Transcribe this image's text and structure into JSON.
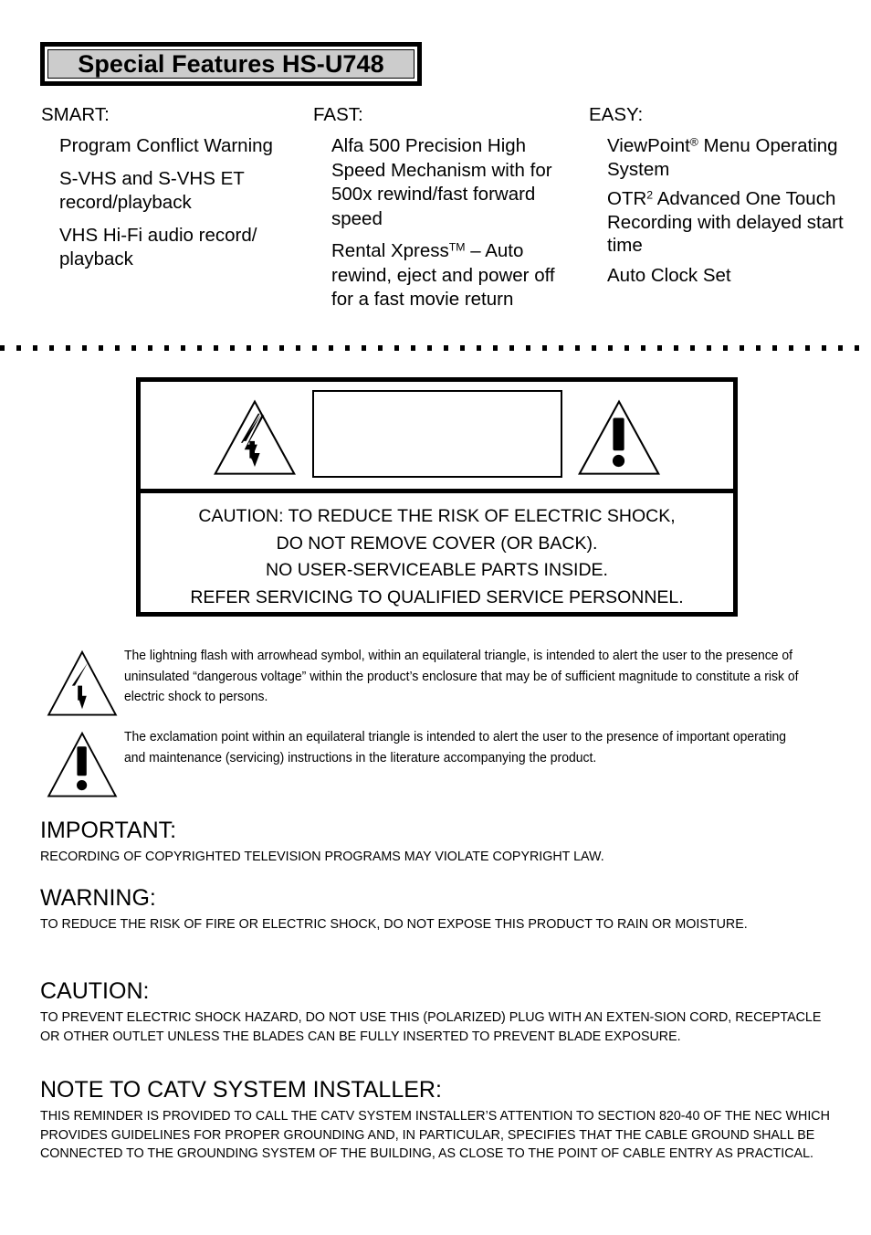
{
  "title": {
    "text": "Special Features HS-U748",
    "fill_color": "#cccccc"
  },
  "features": {
    "columns": [
      {
        "heading": "SMART:",
        "items": [
          "Program Conflict Warning",
          "S-VHS and S-VHS ET record/playback",
          "VHS Hi-Fi audio record/ playback"
        ]
      },
      {
        "heading": "FAST:",
        "items": [
          "Alfa 500 Precision High Speed Mechanism with for 500x rewind/fast forward speed",
          "Rental Xpress™ – Auto rewind, eject and power off for a fast movie return"
        ]
      },
      {
        "heading": "EASY:",
        "items": [
          "ViewPoint® Menu Operating System",
          "OTR² Advanced One Touch Recording with delayed start time",
          "Auto Clock Set"
        ]
      }
    ]
  },
  "caution_box": {
    "lines": [
      "CAUTION:  TO REDUCE THE RISK OF ELECTRIC SHOCK,",
      "DO NOT REMOVE COVER (OR BACK).",
      "NO USER-SERVICEABLE PARTS INSIDE.",
      "REFER SERVICING TO QUALIFIED SERVICE PERSONNEL."
    ]
  },
  "explanations": [
    {
      "icon": "lightning-bolt-triangle-icon",
      "text": "The lightning flash with arrowhead symbol, within an equilateral triangle, is intended to alert the user to the presence of uninsulated “dangerous voltage” within the product’s enclosure that may be of sufficient magnitude to constitute a risk of electric shock to persons."
    },
    {
      "icon": "exclamation-triangle-icon",
      "text": "The exclamation point within an equilateral triangle is intended to alert the user to the presence of important operating and maintenance (servicing) instructions in the literature accompanying the product."
    }
  ],
  "notices": [
    {
      "heading": "IMPORTANT:",
      "body": "RECORDING OF COPYRIGHTED TELEVISION PROGRAMS MAY VIOLATE COPYRIGHT LAW."
    },
    {
      "heading": "WARNING:",
      "body": "TO REDUCE THE RISK OF FIRE OR ELECTRIC SHOCK, DO NOT EXPOSE THIS PRODUCT TO RAIN OR MOISTURE."
    },
    {
      "heading": "CAUTION:",
      "body": "TO PREVENT ELECTRIC SHOCK HAZARD, DO NOT USE THIS (POLARIZED) PLUG WITH AN EXTEN-SION CORD, RECEPTACLE OR OTHER OUTLET UNLESS THE BLADES CAN BE FULLY INSERTED TO PREVENT BLADE EXPOSURE."
    },
    {
      "heading": "NOTE TO CATV SYSTEM INSTALLER:",
      "body": "THIS REMINDER IS PROVIDED TO CALL THE CATV SYSTEM INSTALLER’S ATTENTION TO SECTION 820-40 OF THE NEC WHICH PROVIDES GUIDELINES FOR PROPER GROUNDING AND, IN PARTICULAR, SPECIFIES THAT THE CABLE GROUND SHALL BE CONNECTED TO THE GROUNDING SYSTEM OF THE BUILDING, AS CLOSE TO THE POINT OF CABLE ENTRY AS PRACTICAL."
    }
  ]
}
